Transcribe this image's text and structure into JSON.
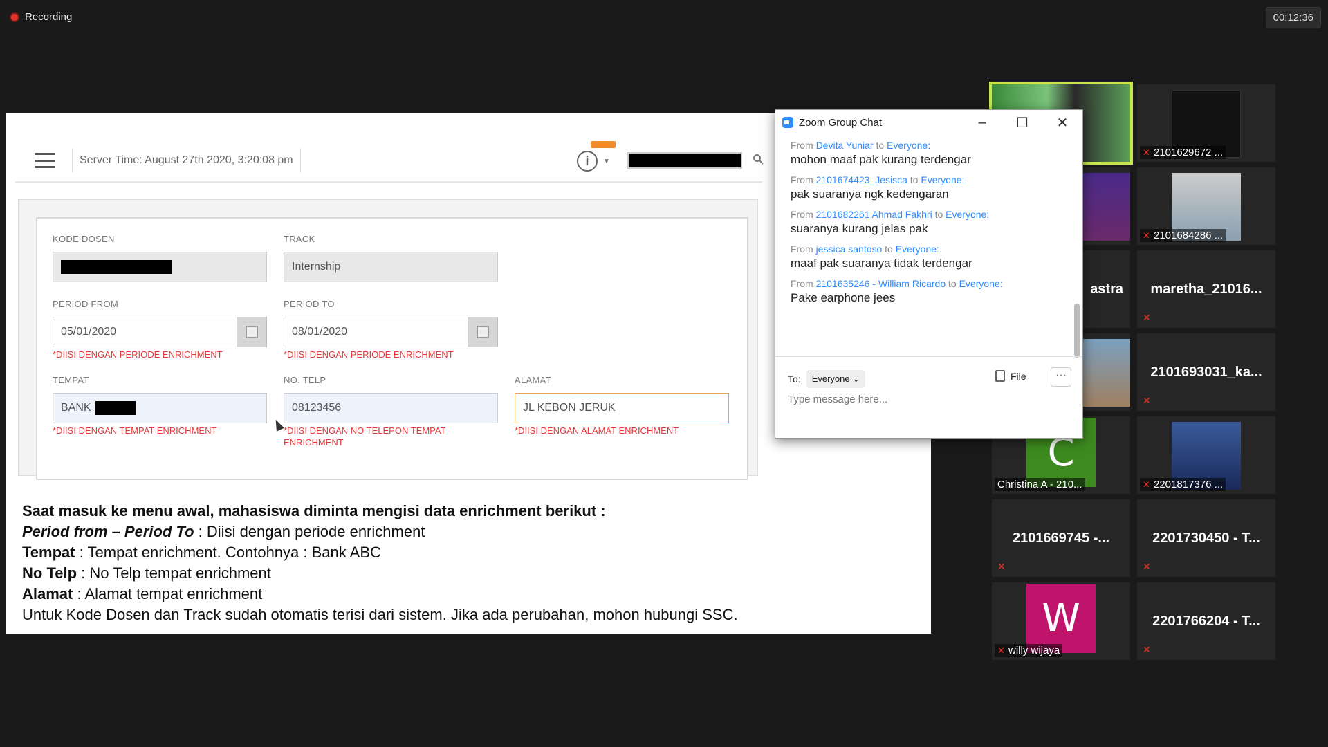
{
  "recording": {
    "label": "Recording"
  },
  "timer": "00:12:36",
  "slide": {
    "server_time": "Server Time: August 27th 2020, 3:20:08 pm",
    "form": {
      "kode_dosen": {
        "label": "KODE DOSEN"
      },
      "track": {
        "label": "TRACK",
        "value": "Internship"
      },
      "period_from": {
        "label": "PERIOD FROM",
        "value": "05/01/2020",
        "error": "*DIISI DENGAN PERIODE ENRICHMENT"
      },
      "period_to": {
        "label": "PERIOD TO",
        "value": "08/01/2020",
        "error": "*DIISI DENGAN PERIODE ENRICHMENT"
      },
      "tempat": {
        "label": "TEMPAT",
        "value": "BANK",
        "error": "*DIISI DENGAN TEMPAT ENRICHMENT"
      },
      "no_telp": {
        "label": "NO. TELP",
        "value": "08123456",
        "error": "*DIISI DENGAN NO TELEPON TEMPAT ENRICHMENT"
      },
      "alamat": {
        "label": "ALAMAT",
        "value": "JL KEBON JERUK",
        "error": "*DIISI DENGAN ALAMAT ENRICHMENT"
      }
    },
    "text": {
      "line1": "Saat masuk ke menu awal, mahasiswa diminta mengisi data enrichment berikut :",
      "line2_bold": "Period from – Period To",
      "line2_rest": " : Diisi dengan periode enrichment",
      "line3_bold": "Tempat",
      "line3_rest": " : Tempat enrichment. Contohnya : Bank ABC",
      "line4_bold": "No Telp",
      "line4_rest": " : No Telp tempat enrichment",
      "line5_bold": "Alamat",
      "line5_rest": " : Alamat tempat enrichment",
      "line6": "Untuk Kode Dosen dan Track sudah otomatis terisi dari sistem. Jika ada perubahan, mohon hubungi SSC."
    }
  },
  "chat": {
    "title": "Zoom Group Chat",
    "messages": [
      {
        "from": "From ",
        "user": "Devita Yuniar",
        "to": " to ",
        "target": "Everyone:",
        "text": "mohon maaf pak kurang terdengar"
      },
      {
        "from": "From ",
        "user": "2101674423_Jesisca",
        "to": " to ",
        "target": "Everyone:",
        "text": "pak suaranya ngk kedengaran"
      },
      {
        "from": "From ",
        "user": "2101682261 Ahmad Fakhri",
        "to": " to ",
        "target": "Everyone:",
        "text": "suaranya kurang jelas pak"
      },
      {
        "from": "From ",
        "user": "jessica santoso",
        "to": " to ",
        "target": "Everyone:",
        "text": "maaf pak suaranya tidak terdengar"
      },
      {
        "from": "From ",
        "user": "2101635246 - William Ricardo",
        "to": " to ",
        "target": "Everyone:",
        "text": "Pake earphone jees"
      }
    ],
    "to_label": "To:",
    "to_value": "Everyone",
    "file_label": "File",
    "more_label": "···",
    "placeholder": "Type message here..."
  },
  "gallery": {
    "t1": {
      "name": "2101629672 ..."
    },
    "t2": {
      "name": "2101684286 ..."
    },
    "t3": {
      "name": "astra"
    },
    "t4": {
      "name": "maretha_21016..."
    },
    "t5": {
      "name": "2101693031_ka..."
    },
    "t6": {
      "name": "Christina A - 210...",
      "initial": "C",
      "color": "#3d8b1f"
    },
    "t7": {
      "name": "2201817376 ..."
    },
    "t8": {
      "name": "2101669745 -..."
    },
    "t9": {
      "name": "2201730450 - T..."
    },
    "t10": {
      "name": "willy wijaya",
      "initial": "W",
      "color": "#c0136b"
    },
    "t11": {
      "name": "2201766204 - T..."
    }
  }
}
